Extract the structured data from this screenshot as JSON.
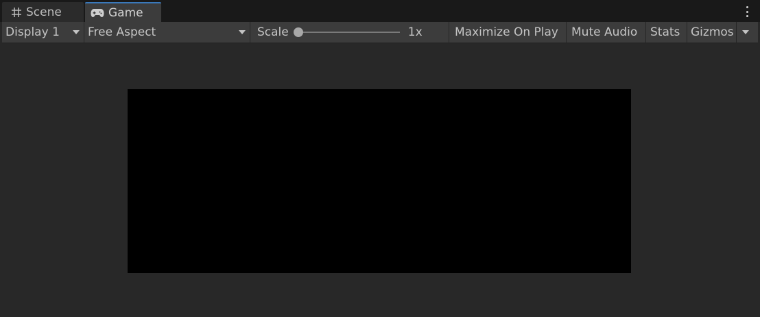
{
  "tabs": [
    {
      "label": "Scene",
      "icon": "grid-hash-icon"
    },
    {
      "label": "Game",
      "icon": "gamepad-icon",
      "active": true
    }
  ],
  "toolbar": {
    "display": "Display 1",
    "aspect": "Free Aspect",
    "scale_label": "Scale",
    "scale_value": "1x",
    "scale_level": 0,
    "maximize_on_play": "Maximize On Play",
    "mute_audio": "Mute Audio",
    "stats": "Stats",
    "gizmos": "Gizmos"
  },
  "colors": {
    "active_tab_accent": "#3a79bb",
    "toolbar_bg": "#3c3c3c",
    "viewport_bg": "#282828",
    "render_bg": "#000000"
  }
}
